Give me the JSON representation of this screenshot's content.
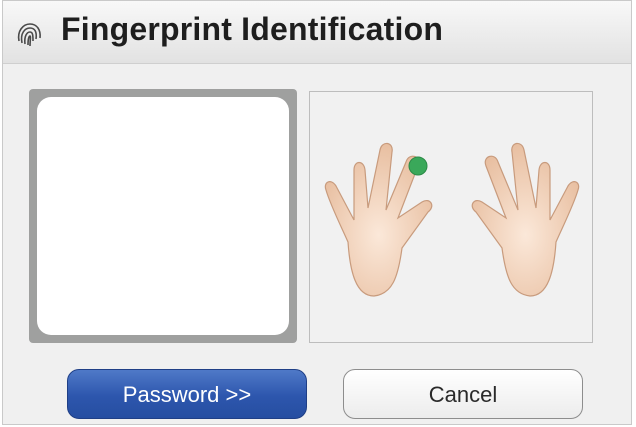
{
  "window": {
    "title": "Fingerprint Identification"
  },
  "icons": {
    "title_icon": "fingerprint-icon"
  },
  "hands": {
    "left_hand_label": "",
    "right_hand_label": "",
    "highlighted_finger": "left-index",
    "highlight_color": "#3aa85a",
    "skin_color": "#f2d5bd"
  },
  "buttons": {
    "password_label": "Password >>",
    "cancel_label": "Cancel"
  },
  "colors": {
    "accent": "#2d56ad",
    "scan_border": "#9fa09f"
  }
}
